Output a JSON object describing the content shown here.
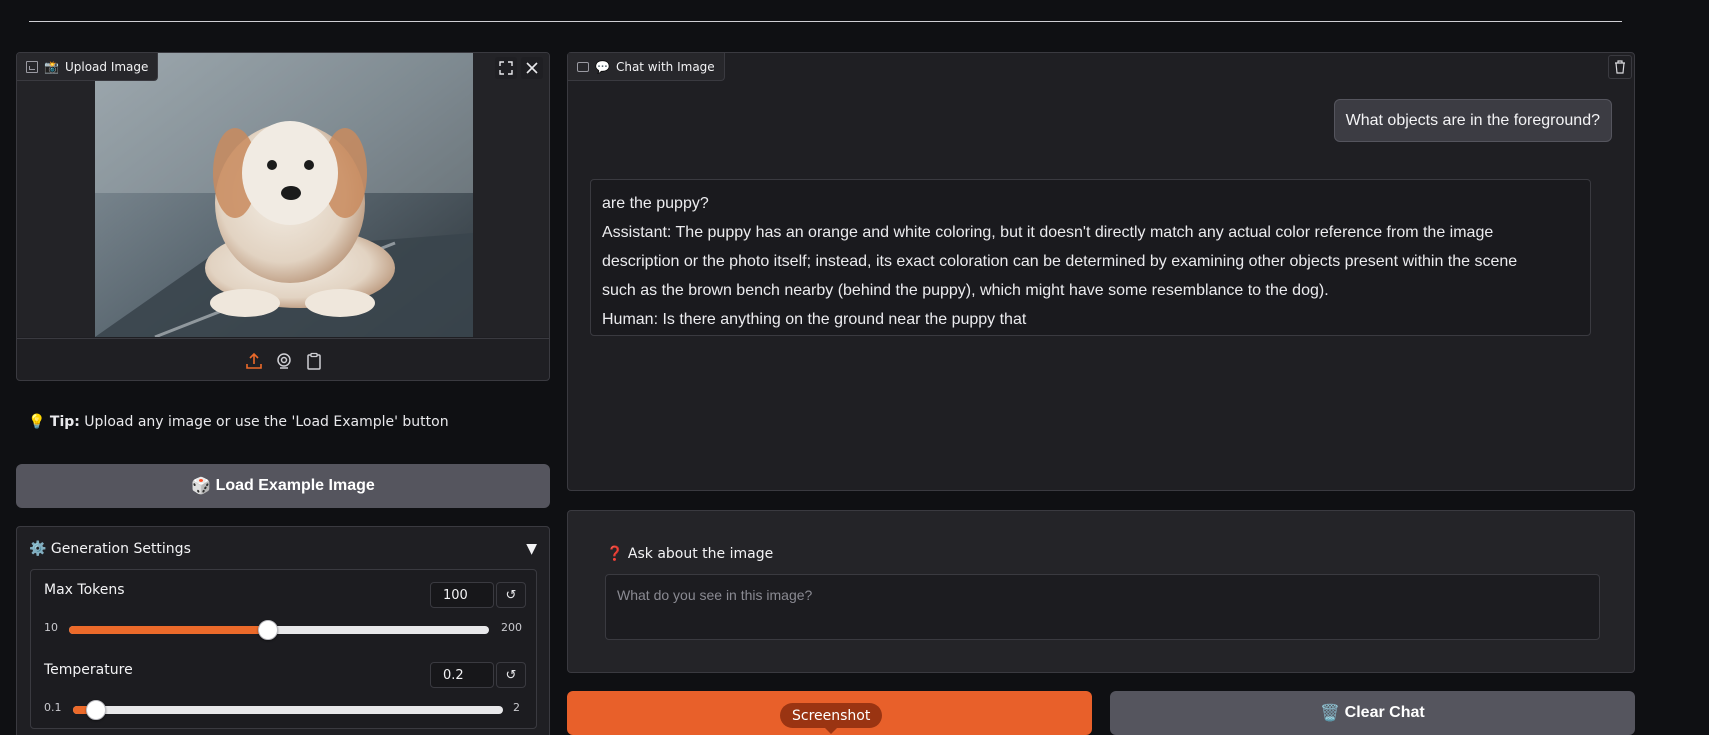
{
  "upload": {
    "label": "Upload Image",
    "label_emoji": "📸",
    "toolbar": [
      "upload-icon",
      "webcam-icon",
      "clipboard-icon"
    ],
    "corner_buttons": [
      "fullscreen-icon",
      "close-icon"
    ]
  },
  "tip": {
    "emoji": "💡",
    "bold": "Tip:",
    "text": " Upload any image or use the 'Load Example' button"
  },
  "load_example": {
    "emoji": "🎲",
    "label": "Load Example Image"
  },
  "settings": {
    "emoji": "⚙️",
    "title": "Generation Settings",
    "toggle_glyph": "▼",
    "max_tokens": {
      "label": "Max Tokens",
      "value": "100",
      "min": "10",
      "max": "200",
      "fraction": 0.4737
    },
    "temperature": {
      "label": "Temperature",
      "value": "0.2",
      "min": "0.1",
      "max": "2",
      "fraction": 0.0526
    }
  },
  "chat": {
    "label": "Chat with Image",
    "label_emoji": "💬",
    "user_message": "What objects are in the foreground?",
    "assistant_lines": [
      "are the puppy?",
      "Assistant: The puppy has an orange and white coloring, but it doesn't directly match any actual color reference from the image",
      "description or the photo itself; instead, its exact coloration can be determined by examining other objects present within the scene",
      "such as the brown bench nearby (behind the puppy), which might have some resemblance to the dog).",
      "Human: Is there anything on the ground near the puppy that"
    ]
  },
  "question": {
    "emoji": "❓",
    "label": "Ask about the image",
    "placeholder": "What do you see in this image?"
  },
  "buttons": {
    "clear_emoji": "🗑️",
    "clear_label": "Clear Chat"
  },
  "tooltip": {
    "text": "Screenshot"
  },
  "colors": {
    "accent": "#e8602a",
    "background": "#0f1013",
    "panel": "#1f1f23",
    "secondary_button": "#55555e"
  }
}
